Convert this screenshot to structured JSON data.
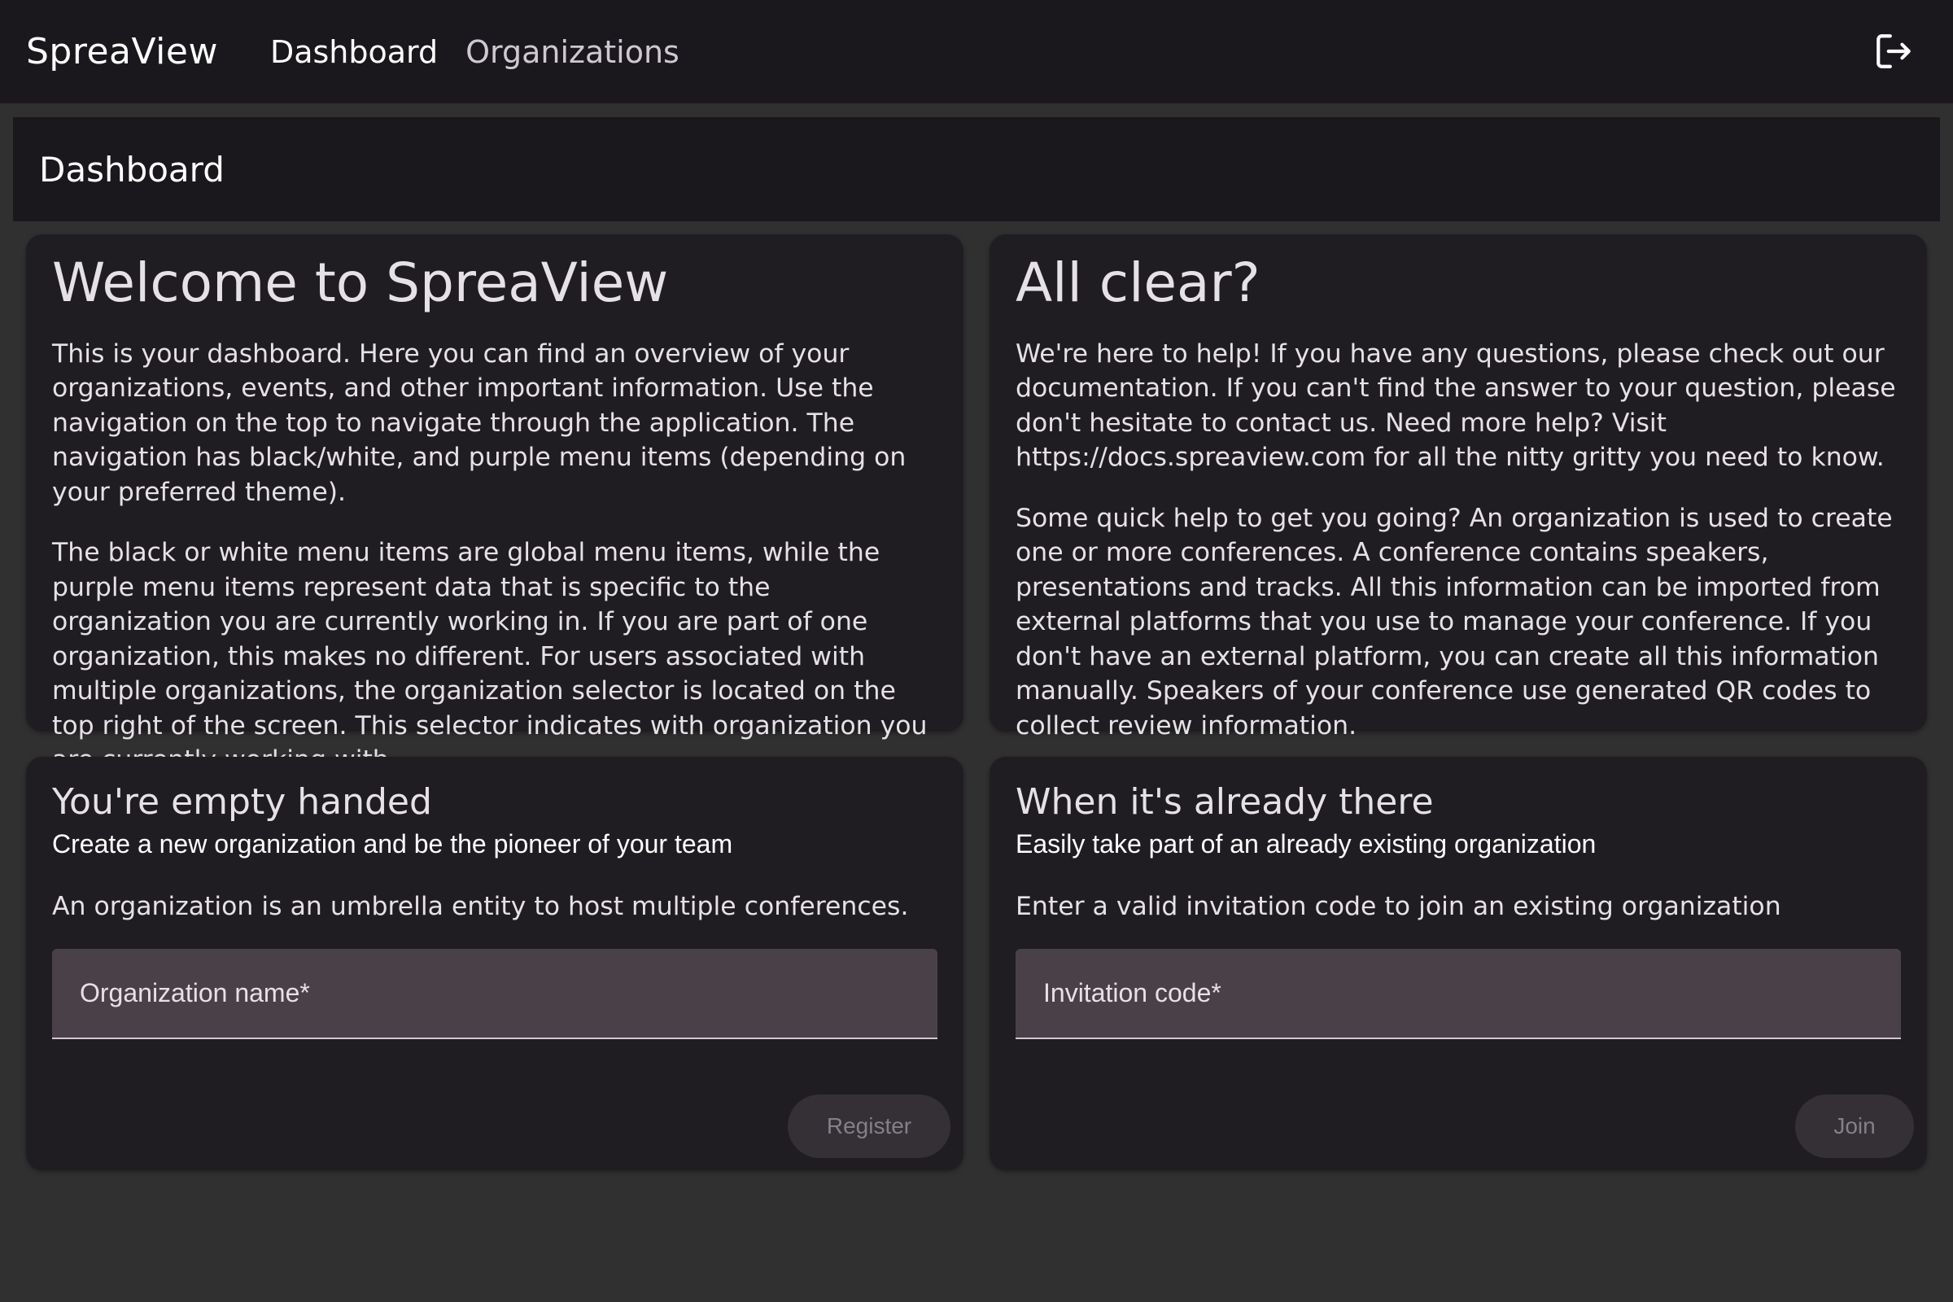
{
  "header": {
    "brand": "SpreaView",
    "nav": [
      {
        "label": "Dashboard",
        "active": true
      },
      {
        "label": "Organizations",
        "active": false
      }
    ],
    "logout_icon": "logout-icon"
  },
  "page": {
    "title": "Dashboard"
  },
  "welcome_card": {
    "heading": "Welcome to SpreaView",
    "paragraphs": [
      "This is your dashboard. Here you can find an overview of your organizations, events, and other important information. Use the navigation on the top to navigate through the application. The navigation has black/white, and purple menu items (depending on your preferred theme).",
      "The black or white menu items are global menu items, while the purple menu items represent data that is specific to the organization you are currently working in. If you are part of one organization, this makes no different. For users associated with multiple organizations, the organization selector is located on the top right of the screen. This selector indicates with organization you are currently working with."
    ]
  },
  "help_card": {
    "heading": "All clear?",
    "paragraphs": [
      "We're here to help! If you have any questions, please check out our documentation. If you can't find the answer to your question, please don't hesitate to contact us. Need more help? Visit https://docs.spreaview.com for all the nitty gritty you need to know.",
      "Some quick help to get you going? An organization is used to create one or more conferences. A conference contains speakers, presentations and tracks. All this information can be imported from external platforms that you use to manage your conference. If you don't have an external platform, you can create all this information manually. Speakers of your conference use generated QR codes to collect review information."
    ]
  },
  "create_org_card": {
    "heading": "You're empty handed",
    "subtitle": "Create a new organization and be the pioneer of your team",
    "description": "An organization is an umbrella entity to host multiple conferences.",
    "input_placeholder": "Organization name*",
    "input_value": "",
    "button_label": "Register"
  },
  "join_org_card": {
    "heading": "When it's already there",
    "subtitle": "Easily take part of an already existing organization",
    "description": "Enter a valid invitation code to join an existing organization",
    "input_placeholder": "Invitation code*",
    "input_value": "",
    "button_label": "Join"
  },
  "colors": {
    "background": "#303030",
    "toolbar": "#1a181c",
    "card": "#201d22",
    "input_fill": "#4a4148",
    "disabled_button": "#343036"
  }
}
